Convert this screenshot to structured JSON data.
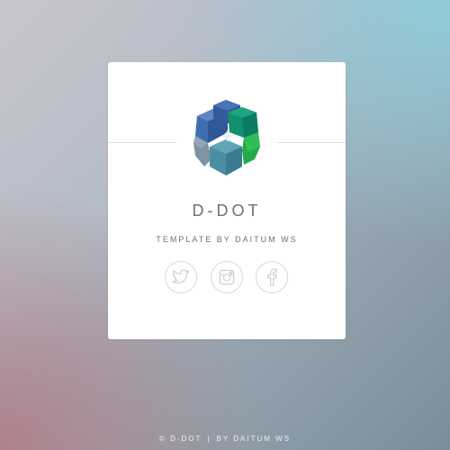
{
  "card": {
    "title": "D-DOT",
    "subtitle": "TEMPLATE BY DAITUM WS"
  },
  "social": [
    {
      "name": "twitter",
      "icon": "twitter-icon"
    },
    {
      "name": "instagram",
      "icon": "instagram-icon"
    },
    {
      "name": "facebook",
      "icon": "facebook-icon"
    }
  ],
  "footer": {
    "copyright": "© D-DOT",
    "separator": "|",
    "credit": "BY DAITUM WS"
  },
  "colors": {
    "logo_blue": "#3f6fb3",
    "logo_green": "#1fa04a",
    "logo_teal": "#4a8fa3",
    "logo_gray": "#7d93a3",
    "text": "#6b7077",
    "icon_stroke": "#c9ced4"
  }
}
